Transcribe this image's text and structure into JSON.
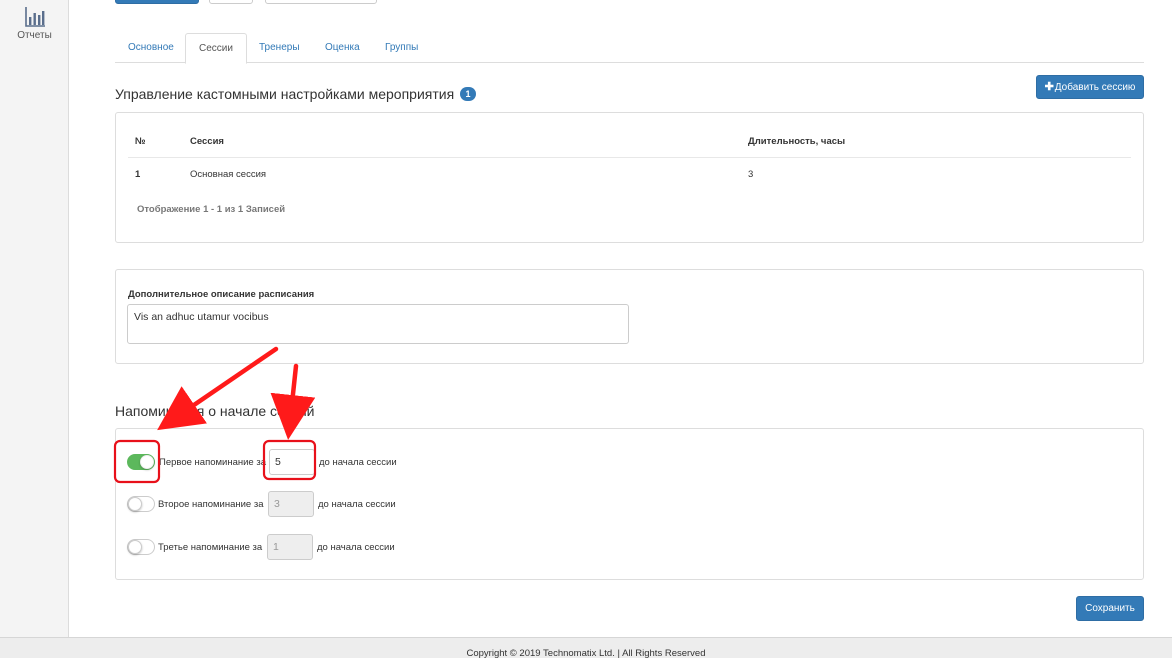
{
  "sidebar": {
    "items": [
      {
        "label": "Отчеты",
        "icon": "bar-chart-icon"
      }
    ]
  },
  "tabs": [
    {
      "label": "Основное",
      "active": false
    },
    {
      "label": "Сессии",
      "active": true
    },
    {
      "label": "Тренеры",
      "active": false
    },
    {
      "label": "Оценка",
      "active": false
    },
    {
      "label": "Группы",
      "active": false
    }
  ],
  "sessions": {
    "title": "Управление кастомными настройками мероприятия",
    "badge": "1",
    "add_button": "Добавить сессию",
    "columns": [
      "№",
      "Сессия",
      "Длительность, часы"
    ],
    "rows": [
      [
        "1",
        "Основная сессия",
        "3"
      ]
    ],
    "info": "Отображение 1 - 1 из 1 Записей"
  },
  "schedule": {
    "label": "Дополнительное описание расписания",
    "value": "Vis an adhuc utamur vocibus"
  },
  "reminders": {
    "title": "Напоминания о начале сессий",
    "items": [
      {
        "label": "Первое напоминание за",
        "value": "5",
        "suffix": "до начала сессии",
        "enabled": true
      },
      {
        "label": "Второе напоминание за",
        "value": "3",
        "suffix": "до начала сессии",
        "enabled": false
      },
      {
        "label": "Третье напоминание за",
        "value": "1",
        "suffix": "до начала сессии",
        "enabled": false
      }
    ]
  },
  "save_button": "Сохранить",
  "footer": "Copyright © 2019 Technomatix Ltd. | All Rights Reserved",
  "colors": {
    "primary": "#337ab7",
    "toggle_on": "#5cb85c",
    "annotation": "#ff1a1a"
  }
}
